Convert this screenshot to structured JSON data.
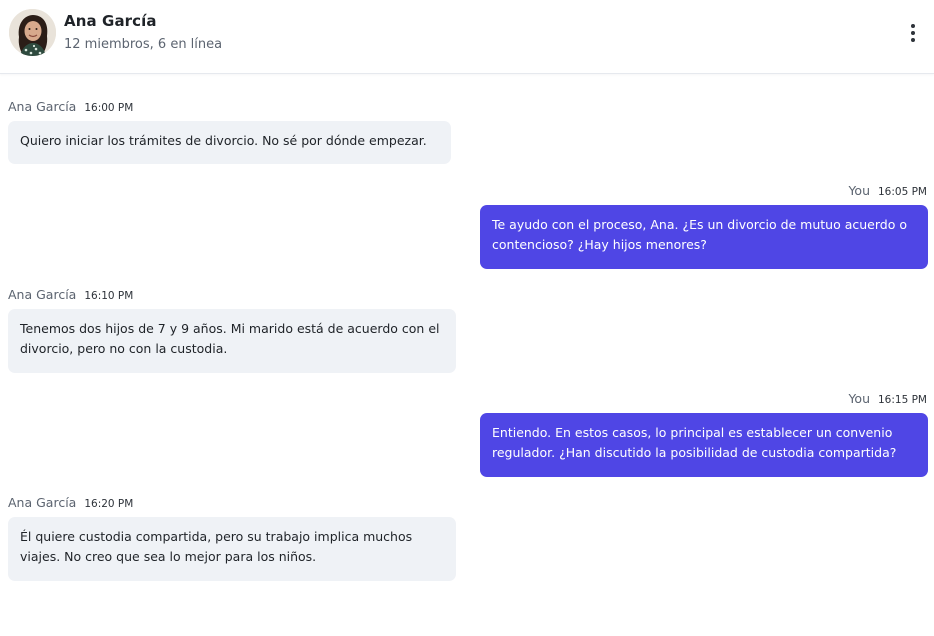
{
  "header": {
    "name": "Ana García",
    "subtitle": "12 miembros, 6 en línea",
    "avatar_icon": "user-avatar-photo",
    "menu_icon": "more-vertical-icon"
  },
  "colors": {
    "outgoing_bubble": "#4f46e5",
    "incoming_bubble": "#eff2f6",
    "text_primary": "#1f2328",
    "text_muted": "#5c6470"
  },
  "messages": [
    {
      "sender": "Ana García",
      "time": "16:00 PM",
      "direction": "incoming",
      "text": "Quiero iniciar los trámites de divorcio. No sé por dónde empezar."
    },
    {
      "sender": "You",
      "time": "16:05 PM",
      "direction": "outgoing",
      "text": "Te ayudo con el proceso, Ana. ¿Es un divorcio de mutuo acuerdo o contencioso? ¿Hay hijos menores?"
    },
    {
      "sender": "Ana García",
      "time": "16:10 PM",
      "direction": "incoming",
      "text": "Tenemos dos hijos de 7 y 9 años. Mi marido está de acuerdo con el divorcio, pero no con la custodia."
    },
    {
      "sender": "You",
      "time": "16:15 PM",
      "direction": "outgoing",
      "text": "Entiendo. En estos casos, lo principal es establecer un convenio regulador. ¿Han discutido la posibilidad de custodia compartida?"
    },
    {
      "sender": "Ana García",
      "time": "16:20 PM",
      "direction": "incoming",
      "text": "Él quiere custodia compartida, pero su trabajo implica muchos viajes. No creo que sea lo mejor para los niños."
    }
  ]
}
